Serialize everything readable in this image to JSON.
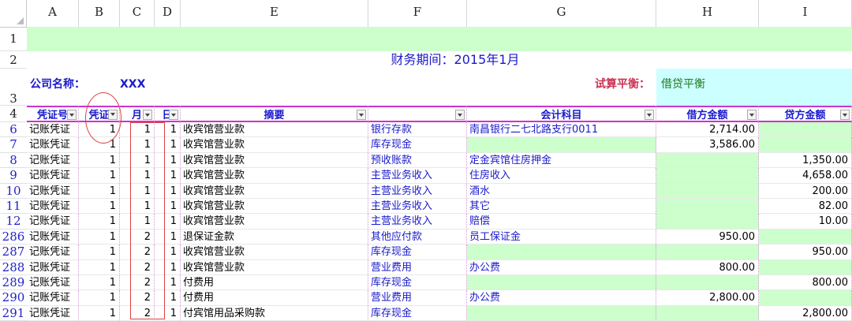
{
  "columns": [
    "A",
    "B",
    "C",
    "D",
    "E",
    "F",
    "G",
    "H",
    "I"
  ],
  "row_numbers": [
    "1",
    "2",
    "3",
    "4",
    "6",
    "7",
    "8",
    "9",
    "10",
    "11",
    "12",
    "286",
    "287",
    "288",
    "289",
    "290",
    "291"
  ],
  "title": "财务期间：2015年1月",
  "company_label": "公司名称：",
  "company_value": "XXX",
  "balance_label": "试算平衡：",
  "balance_value": "借贷平衡",
  "headers": {
    "a": "凭证号",
    "b": "凭证",
    "c": "月",
    "d": "日",
    "e": "摘要",
    "f": "",
    "g": "会计科目",
    "h": "借方金额",
    "i": "贷方金额"
  },
  "rows": [
    {
      "type": "记账凭证",
      "num": "1",
      "month": "1",
      "day": "1",
      "summary": "收宾馆营业款",
      "acct1": "银行存款",
      "acct2": "南昌银行二七北路支行0011",
      "debit": "2,714.00",
      "credit": ""
    },
    {
      "type": "记账凭证",
      "num": "1",
      "month": "1",
      "day": "1",
      "summary": "收宾馆营业款",
      "acct1": "库存现金",
      "acct2": "",
      "debit": "3,586.00",
      "credit": ""
    },
    {
      "type": "记账凭证",
      "num": "1",
      "month": "1",
      "day": "1",
      "summary": "收宾馆营业款",
      "acct1": "预收账款",
      "acct2": "定金宾馆住房押金",
      "debit": "",
      "credit": "1,350.00"
    },
    {
      "type": "记账凭证",
      "num": "1",
      "month": "1",
      "day": "1",
      "summary": "收宾馆营业款",
      "acct1": "主营业务收入",
      "acct2": "住房收入",
      "debit": "",
      "credit": "4,658.00"
    },
    {
      "type": "记账凭证",
      "num": "1",
      "month": "1",
      "day": "1",
      "summary": "收宾馆营业款",
      "acct1": "主营业务收入",
      "acct2": "酒水",
      "debit": "",
      "credit": "200.00"
    },
    {
      "type": "记账凭证",
      "num": "1",
      "month": "1",
      "day": "1",
      "summary": "收宾馆营业款",
      "acct1": "主营业务收入",
      "acct2": "其它",
      "debit": "",
      "credit": "82.00"
    },
    {
      "type": "记账凭证",
      "num": "1",
      "month": "1",
      "day": "1",
      "summary": "收宾馆营业款",
      "acct1": "主营业务收入",
      "acct2": "赔偿",
      "debit": "",
      "credit": "10.00"
    },
    {
      "type": "记账凭证",
      "num": "1",
      "month": "2",
      "day": "1",
      "summary": "退保证金款",
      "acct1": "其他应付款",
      "acct2": "员工保证金",
      "debit": "950.00",
      "credit": ""
    },
    {
      "type": "记账凭证",
      "num": "1",
      "month": "2",
      "day": "1",
      "summary": "收宾馆营业款",
      "acct1": "库存现金",
      "acct2": "",
      "debit": "",
      "credit": "950.00"
    },
    {
      "type": "记账凭证",
      "num": "1",
      "month": "2",
      "day": "1",
      "summary": "收宾馆营业款",
      "acct1": "营业费用",
      "acct2": "办公费",
      "debit": "800.00",
      "credit": ""
    },
    {
      "type": "记账凭证",
      "num": "1",
      "month": "2",
      "day": "1",
      "summary": "付费用",
      "acct1": "库存现金",
      "acct2": "",
      "debit": "",
      "credit": "800.00"
    },
    {
      "type": "记账凭证",
      "num": "1",
      "month": "2",
      "day": "1",
      "summary": "付费用",
      "acct1": "营业费用",
      "acct2": "办公费",
      "debit": "2,800.00",
      "credit": ""
    },
    {
      "type": "记账凭证",
      "num": "1",
      "month": "2",
      "day": "1",
      "summary": "付宾馆用品采购款",
      "acct1": "库存现金",
      "acct2": "",
      "debit": "",
      "credit": "2,800.00"
    }
  ]
}
